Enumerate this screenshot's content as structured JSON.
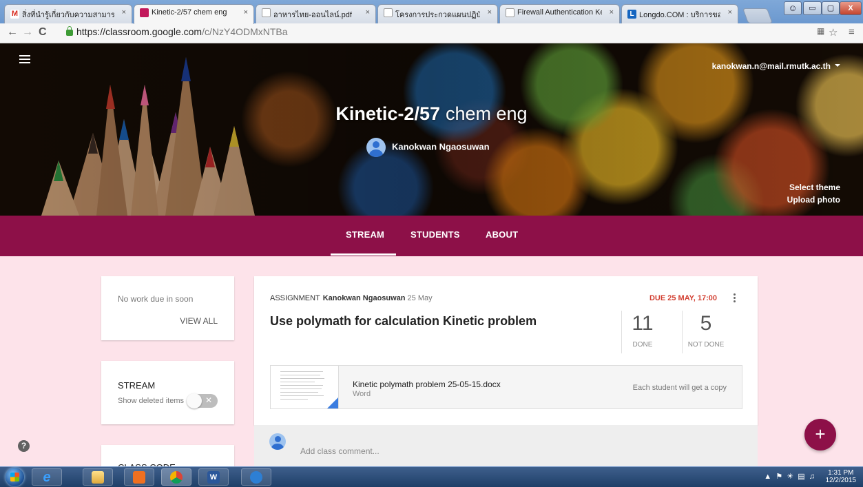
{
  "browser": {
    "tabs": [
      {
        "title": "สิ่งที่นำรู้เกี่ยวกับความสามารถใน",
        "favicon": "gmail-icon",
        "active": false
      },
      {
        "title": "Kinetic-2/57 chem eng",
        "favicon": "classroom-icon",
        "active": true
      },
      {
        "title": "อาหารไทย-ออนไลน์.pdf",
        "favicon": "page-icon",
        "active": false
      },
      {
        "title": "โครงการประกวดแผนปฏิบัติก",
        "favicon": "page-icon",
        "active": false
      },
      {
        "title": "Firewall Authentication Ke",
        "favicon": "page-icon",
        "active": false
      },
      {
        "title": "Longdo.COM : บริการของ",
        "favicon": "longdo-icon",
        "active": false
      }
    ],
    "close_glyph": "×",
    "url_host": "https://classroom.google.com",
    "url_path": "/c/NzY4ODMxNTBa",
    "window_controls": {
      "minimize": "▭",
      "maximize": "▢",
      "close": "X"
    }
  },
  "header": {
    "account": "kanokwan.n@mail.rmutk.ac.th",
    "class_name": "Kinetic-2/57",
    "class_section": "chem eng",
    "teacher": "Kanokwan Ngaosuwan",
    "select_theme": "Select theme",
    "upload_photo": "Upload photo"
  },
  "class_tabs": [
    {
      "label": "STREAM",
      "active": true
    },
    {
      "label": "STUDENTS",
      "active": false
    },
    {
      "label": "ABOUT",
      "active": false
    }
  ],
  "sidebar": {
    "upcoming_text": "No work due in soon",
    "view_all": "VIEW ALL",
    "stream_heading": "STREAM",
    "show_deleted": "Show deleted items",
    "show_deleted_on": false,
    "class_code_heading": "CLASS CODE"
  },
  "post": {
    "type": "ASSIGNMENT",
    "author": "Kanokwan Ngaosuwan",
    "date": "25 May",
    "due": "DUE 25 MAY, 17:00",
    "title": "Use polymath for calculation Kinetic problem",
    "done_count": "11",
    "done_label": "DONE",
    "not_done_count": "5",
    "not_done_label": "NOT DONE",
    "attachment": {
      "name": "Kinetic polymath problem 25-05-15.docx",
      "type": "Word",
      "note": "Each student will get a copy"
    },
    "comment_placeholder": "Add class comment..."
  },
  "fab_label": "+",
  "help_label": "?",
  "taskbar": {
    "time": "1:31 PM",
    "date": "12/2/2015"
  },
  "colors": {
    "primary": "#8d1048",
    "page_bg": "#fde3ea",
    "due_red": "#d23f31"
  }
}
